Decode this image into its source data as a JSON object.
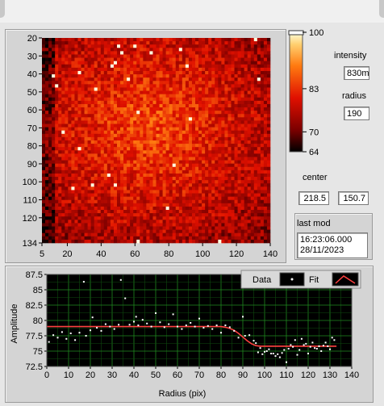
{
  "heatmap": {
    "y_ticks": [
      "20",
      "30",
      "40",
      "50",
      "60",
      "70",
      "80",
      "90",
      "100",
      "110",
      "120",
      "134"
    ],
    "x_ticks": [
      "5",
      "20",
      "40",
      "60",
      "80",
      "100",
      "120",
      "140"
    ],
    "x_range": [
      5,
      140
    ],
    "y_range": [
      20,
      134
    ]
  },
  "colorbar": {
    "labels": [
      "100",
      "83",
      "70",
      "64"
    ],
    "values": [
      100,
      83,
      70,
      64
    ],
    "colors": [
      "#000000",
      "#7a0000",
      "#e01000",
      "#ff7a10",
      "#ffd070",
      "#ffffe0"
    ]
  },
  "intensity": {
    "label": "intensity",
    "value": "830m"
  },
  "radius": {
    "label": "radius",
    "value": "190"
  },
  "center": {
    "label": "center",
    "x": "218.5",
    "y": "150.7"
  },
  "last_mod": {
    "label": "last mod",
    "time": "16:23:06.000",
    "date": "28/11/2023"
  },
  "plot": {
    "legend": {
      "data_label": "Data",
      "fit_label": "Fit"
    },
    "colors": {
      "background": "#000000",
      "grid": "#1f8a1f",
      "data": "#ffffff",
      "fit": "#ff4040"
    }
  },
  "chart_data": {
    "type": "scatter",
    "xlabel": "Radius (pix)",
    "ylabel": "Amplitude",
    "xlim": [
      0,
      140
    ],
    "ylim": [
      72.5,
      87.5
    ],
    "x_ticks": [
      0,
      10,
      20,
      30,
      40,
      50,
      60,
      70,
      80,
      90,
      100,
      110,
      120,
      130,
      140
    ],
    "y_ticks": [
      72.5,
      75,
      77.5,
      80,
      82.5,
      85,
      87.5
    ],
    "grid": true,
    "legend_position": "top-right",
    "series": [
      {
        "name": "Data",
        "kind": "points",
        "x": [
          1,
          3,
          5,
          7,
          9,
          11,
          13,
          15,
          17,
          18,
          20,
          21,
          23,
          25,
          27,
          29,
          31,
          33,
          34,
          36,
          38,
          40,
          41,
          42,
          44,
          46,
          48,
          50,
          52,
          54,
          56,
          58,
          60,
          62,
          64,
          66,
          68,
          70,
          72,
          74,
          76,
          78,
          80,
          82,
          84,
          86,
          88,
          90,
          91,
          93,
          95,
          96,
          97,
          98,
          99,
          100,
          101,
          102,
          103,
          104,
          105,
          106,
          107,
          108,
          109,
          110,
          111,
          112,
          113,
          114,
          115,
          116,
          117,
          118,
          119,
          120,
          121,
          122,
          123,
          124,
          125,
          126,
          127,
          128,
          129,
          130,
          131,
          132
        ],
        "y": [
          76.5,
          77.6,
          77.2,
          78.1,
          77.0,
          77.9,
          76.8,
          78.0,
          86.3,
          77.5,
          78.4,
          80.5,
          78.8,
          78.3,
          79.4,
          79.0,
          78.6,
          79.3,
          86.6,
          83.6,
          79.3,
          79.8,
          80.6,
          79.2,
          80.1,
          79.5,
          79.0,
          81.2,
          79.7,
          78.9,
          79.4,
          81.0,
          79.0,
          78.6,
          79.2,
          79.6,
          79.0,
          80.3,
          78.8,
          79.1,
          78.6,
          79.2,
          78.0,
          79.2,
          78.9,
          78.3,
          77.2,
          80.6,
          77.5,
          77.6,
          76.7,
          76.3,
          74.8,
          75.5,
          74.5,
          74.9,
          75.0,
          75.3,
          74.6,
          74.6,
          74.2,
          74.5,
          74.0,
          74.7,
          75.2,
          73.2,
          75.4,
          76.0,
          75.7,
          76.8,
          74.4,
          75.2,
          77.0,
          76.0,
          76.2,
          74.6,
          75.7,
          76.4,
          75.5,
          75.4,
          75.8,
          75.0,
          75.9,
          76.4,
          75.8,
          75.3,
          77.2,
          76.8
        ]
      },
      {
        "name": "Fit",
        "kind": "line",
        "x": [
          0,
          80,
          82,
          84,
          86,
          88,
          90,
          92,
          94,
          96,
          98,
          100,
          133
        ],
        "y": [
          79.0,
          79.0,
          78.9,
          78.7,
          78.4,
          77.9,
          77.3,
          76.7,
          76.2,
          75.9,
          75.8,
          75.8,
          75.8
        ]
      }
    ]
  }
}
